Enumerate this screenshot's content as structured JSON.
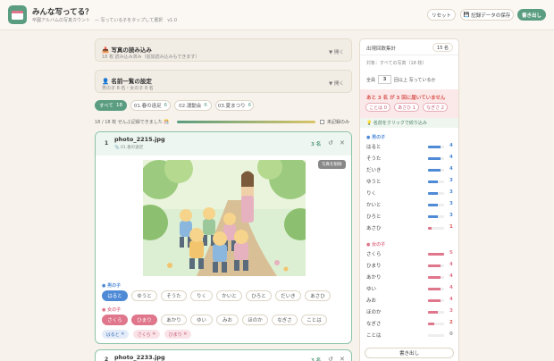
{
  "app": {
    "title": "みんな写ってる？",
    "subtitle": "卒園アルバムの写真カウント",
    "hint": "— 写っている子をタップして選択",
    "version": "v1.0"
  },
  "actions": {
    "reset": "リセット",
    "save": "記録データの保存",
    "export": "書き出し"
  },
  "load_card": {
    "icon": "📥",
    "title": "写真の読み込み",
    "status": "18 枚 読み込み済み（追加読み込みもできます）",
    "toggle": "▼ 開く"
  },
  "names_card": {
    "icon": "👤",
    "title": "名前一覧の設定",
    "status": "男の子 8 名・女の子 8 名",
    "toggle": "▼ 開く"
  },
  "filters": [
    {
      "label": "すべて",
      "count": "18"
    },
    {
      "label": "01.春の遠足",
      "count": "6"
    },
    {
      "label": "02.運動会",
      "count": "6"
    },
    {
      "label": "03.夏まつり",
      "count": "6"
    }
  ],
  "progress": {
    "text": "18 / 18 枚 ぜんぶ記録できました 🎊",
    "unrecorded_only": "未記録のみ",
    "ratio": 1.0
  },
  "photo1": {
    "index": "1",
    "filename": "photo_2215.jpg",
    "folder": "📎 01.春の遠足",
    "count": "3 名",
    "delete": "写真を削除",
    "image_alt": "遠足の写真"
  },
  "boys_label": "● 男の子",
  "girls_label": "● 女の子",
  "boys": [
    "はると",
    "ゆうと",
    "そうた",
    "りく",
    "かいと",
    "ひろと",
    "だいき",
    "あさひ"
  ],
  "girls": [
    "さくら",
    "ひまり",
    "あかり",
    "ゆい",
    "みお",
    "ほのか",
    "なぎさ",
    "ことは"
  ],
  "selected_boys": [
    "はると"
  ],
  "selected_girls": [
    "さくら",
    "ひまり"
  ],
  "selected_tags": [
    {
      "label": "はると",
      "gender": "b"
    },
    {
      "label": "さくら",
      "gender": "g"
    },
    {
      "label": "ひまり",
      "gender": "g"
    }
  ],
  "photo2": {
    "index": "2",
    "filename": "photo_2233.jpg",
    "count": "3 名"
  },
  "summary": {
    "title": "出現回数集計",
    "people": "15 名",
    "target": "対象：すべての写真（18 枚）",
    "min_label": "全員",
    "min_value": "3",
    "min_suffix": "回以上 写っているか",
    "warning": "あと 3 名 が 3 回に届いていません",
    "warn_names": [
      "ことは 0",
      "あさひ 1",
      "なぎさ 2"
    ],
    "hint": "💡 名前をクリックで絞り込み",
    "boys_label": "● 男の子",
    "girls_label": "● 女の子",
    "boys": [
      {
        "name": "はると",
        "value": 4
      },
      {
        "name": "そうた",
        "value": 4
      },
      {
        "name": "だいき",
        "value": 4
      },
      {
        "name": "ゆうと",
        "value": 3
      },
      {
        "name": "りく",
        "value": 3
      },
      {
        "name": "かいと",
        "value": 3
      },
      {
        "name": "ひろと",
        "value": 3
      },
      {
        "name": "あさひ",
        "value": 1
      }
    ],
    "girls": [
      {
        "name": "さくら",
        "value": 5
      },
      {
        "name": "ひまり",
        "value": 4
      },
      {
        "name": "あかり",
        "value": 4
      },
      {
        "name": "ゆい",
        "value": 4
      },
      {
        "name": "みお",
        "value": 4
      },
      {
        "name": "ほのか",
        "value": 3
      },
      {
        "name": "なぎさ",
        "value": 2
      },
      {
        "name": "ことは",
        "value": 0
      }
    ],
    "export": "書き出し"
  },
  "colors": {
    "accent": "#5a9d80",
    "boy": "#4f8ad6",
    "girl": "#e0768b",
    "warn": "#d9534f"
  }
}
